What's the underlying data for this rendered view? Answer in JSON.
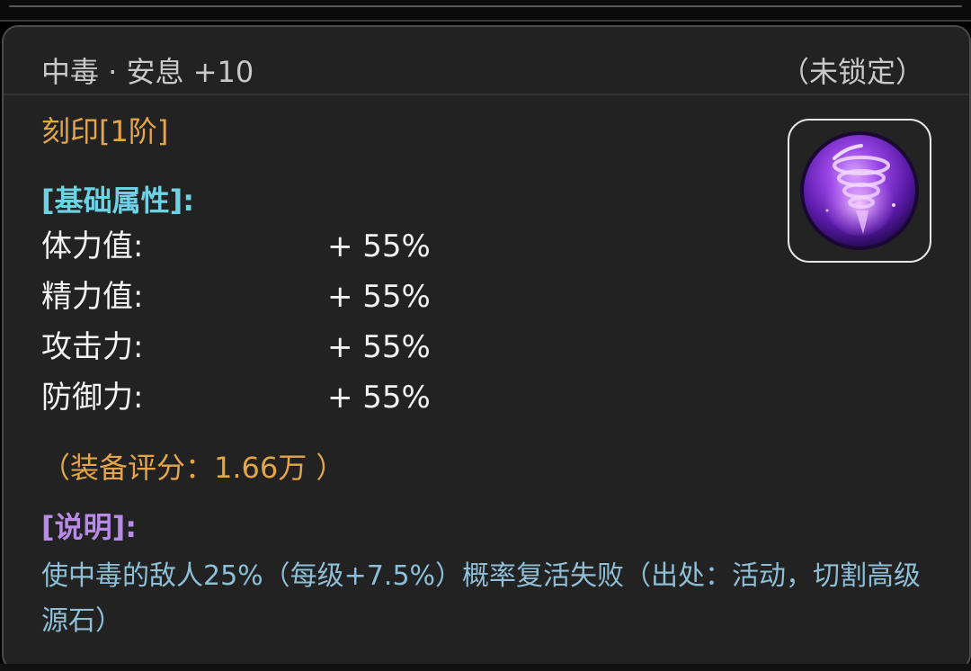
{
  "item": {
    "title": "中毒 · 安息 +10",
    "lock_status": "（未锁定）",
    "tier": "刻印[1阶]",
    "icon": "poison-tornado-orb-icon"
  },
  "base_attributes": {
    "heading": "[基础属性]:",
    "stats": [
      {
        "label": "体力值:",
        "value": "+ 55%"
      },
      {
        "label": "精力值:",
        "value": "+ 55%"
      },
      {
        "label": "攻击力:",
        "value": "+ 55%"
      },
      {
        "label": "防御力:",
        "value": "+ 55%"
      }
    ]
  },
  "score": "（装备评分：1.66万 ）",
  "description": {
    "heading": "[说明]:",
    "text": "使中毒的敌人25%（每级+7.5%）概率复活失败（出处：活动，切割高级源石）"
  },
  "colors": {
    "panel_bg": "#222223",
    "title": "#c9c9c9",
    "tier": "#e3a54b",
    "section_base": "#6fd2e4",
    "section_desc": "#b88be6",
    "desc_text": "#8fbfd6",
    "icon_orb": "#7a2fd0"
  }
}
